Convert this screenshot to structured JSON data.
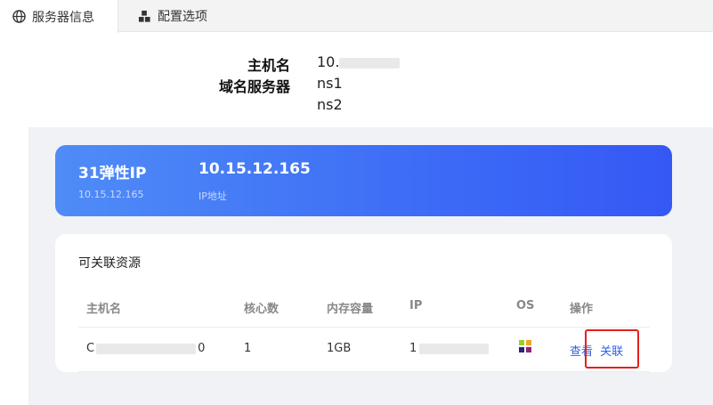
{
  "tabs": [
    {
      "label": "服务器信息",
      "icon": "globe-icon",
      "active": true
    },
    {
      "label": "配置选项",
      "icon": "cubes-icon",
      "active": false
    }
  ],
  "server_info": {
    "hostname_label": "主机名",
    "hostname_value_visible": "10.",
    "dns_label": "域名服务器",
    "dns_values": [
      "ns1",
      "ns2"
    ]
  },
  "ip_card": {
    "title": "31弹性IP",
    "title_sub": "10.15.12.165",
    "ip": "10.15.12.165",
    "ip_sub": "IP地址"
  },
  "resources": {
    "title": "可关联资源",
    "columns": [
      "主机名",
      "核心数",
      "内存容量",
      "IP",
      "OS",
      "操作"
    ],
    "rows": [
      {
        "hostname_prefix": "C",
        "hostname_suffix": "0",
        "cores": "1",
        "memory": "1GB",
        "ip_prefix": "1",
        "os_icon": "centos-icon",
        "actions": [
          "查看",
          "关联"
        ]
      }
    ]
  },
  "colors": {
    "accent": "#3e6ef6",
    "highlight": "#e51f1f",
    "link": "#2f62e6"
  }
}
